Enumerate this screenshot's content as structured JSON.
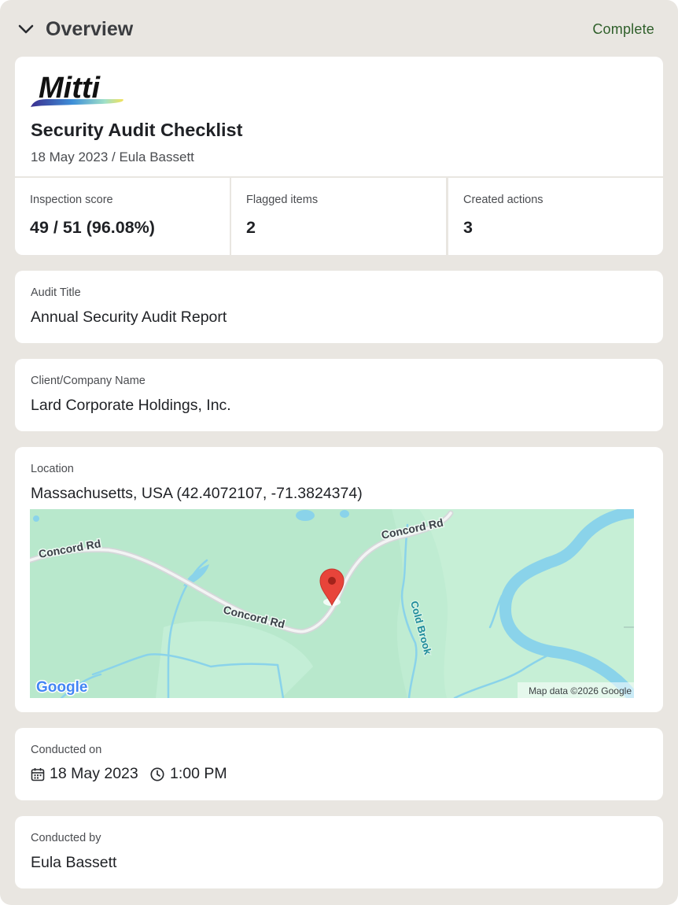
{
  "header": {
    "title": "Overview",
    "status": "Complete",
    "status_color": "#2f5f2a"
  },
  "report": {
    "logo_text": "Mitti",
    "title": "Security Audit Checklist",
    "subtitle": "18 May 2023 / Eula Bassett"
  },
  "stats": [
    {
      "label": "Inspection score",
      "value": "49 / 51 (96.08%)"
    },
    {
      "label": "Flagged items",
      "value": "2"
    },
    {
      "label": "Created actions",
      "value": "3"
    }
  ],
  "fields": {
    "audit_title": {
      "label": "Audit Title",
      "value": "Annual Security Audit Report"
    },
    "client": {
      "label": "Client/Company Name",
      "value": "Lard Corporate Holdings, Inc."
    },
    "location": {
      "label": "Location",
      "value": "Massachusetts, USA (42.4072107, -71.3824374)"
    },
    "conducted_on": {
      "label": "Conducted on",
      "date": "18 May 2023",
      "time": "1:00 PM"
    },
    "conducted_by": {
      "label": "Conducted by",
      "value": "Eula Bassett"
    }
  },
  "map": {
    "road_label_1": "Concord Rd",
    "road_label_2": "Concord Rd",
    "road_label_3": "Concord Rd",
    "stream_label": "Cold Brook",
    "brand": "Google",
    "attribution": "Map data ©2026 Google",
    "icons": [
      "map-pin-icon"
    ]
  },
  "icons": {
    "collapse": "chevron-down-icon",
    "date": "calendar-icon",
    "time": "clock-icon"
  }
}
